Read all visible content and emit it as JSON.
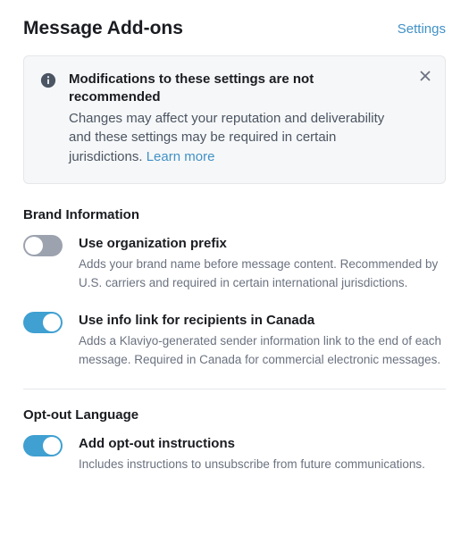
{
  "header": {
    "title": "Message Add-ons",
    "settings_link": "Settings"
  },
  "alert": {
    "title": "Modifications to these settings are not recommended",
    "description": "Changes may affect your reputation and deliverability and these settings may be required in certain jurisdictions. ",
    "learn_more": "Learn more"
  },
  "sections": {
    "brand": {
      "title": "Brand Information",
      "items": [
        {
          "enabled": false,
          "title": "Use organization prefix",
          "description": "Adds your brand name before message content. Recommended by U.S. carriers and required in certain international jurisdictions."
        },
        {
          "enabled": true,
          "title": "Use info link for recipients in Canada",
          "description": "Adds a Klaviyo-generated sender information link to the end of each message. Required in Canada for commercial electronic messages."
        }
      ]
    },
    "optout": {
      "title": "Opt-out Language",
      "items": [
        {
          "enabled": true,
          "title": "Add opt-out instructions",
          "description": "Includes instructions to unsubscribe from future communications."
        }
      ]
    }
  }
}
